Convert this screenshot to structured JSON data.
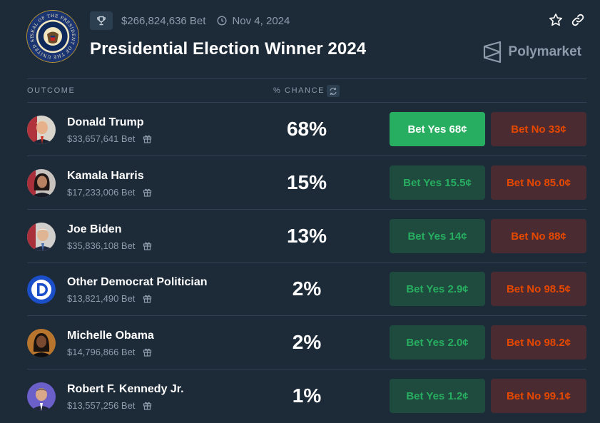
{
  "header": {
    "seal_text": "SEAL OF THE PRESIDENT OF THE UNITED STATES",
    "volume": "$266,824,636 Bet",
    "end_date": "Nov 4, 2024",
    "title": "Presidential Election Winner 2024",
    "brand": "Polymarket",
    "icons": [
      "trophy-icon",
      "clock-icon",
      "star-icon",
      "link-icon",
      "polymarket-logo-icon"
    ]
  },
  "table": {
    "col_outcome": "OUTCOME",
    "col_chance": "% CHANCE"
  },
  "outcomes": [
    {
      "name": "Donald Trump",
      "volume": "$33,657,641 Bet",
      "chance": "68%",
      "yes": "Bet Yes 68¢",
      "no": "Bet No 33¢"
    },
    {
      "name": "Kamala Harris",
      "volume": "$17,233,006 Bet",
      "chance": "15%",
      "yes": "Bet Yes 15.5¢",
      "no": "Bet No 85.0¢"
    },
    {
      "name": "Joe Biden",
      "volume": "$35,836,108 Bet",
      "chance": "13%",
      "yes": "Bet Yes 14¢",
      "no": "Bet No 88¢"
    },
    {
      "name": "Other Democrat Politician",
      "volume": "$13,821,490 Bet",
      "chance": "2%",
      "yes": "Bet Yes 2.9¢",
      "no": "Bet No 98.5¢"
    },
    {
      "name": "Michelle Obama",
      "volume": "$14,796,866 Bet",
      "chance": "2%",
      "yes": "Bet Yes 2.0¢",
      "no": "Bet No 98.2¢"
    },
    {
      "name": "Robert F. Kennedy Jr.",
      "volume": "$13,557,256 Bet",
      "chance": "1%",
      "yes": "Bet Yes 1.2¢",
      "no": "Bet No 99.1¢"
    }
  ],
  "colors": {
    "background": "#1d2b39",
    "yes_green": "#27ae60",
    "no_orange": "#e64800",
    "muted_text": "#8c9cab"
  }
}
